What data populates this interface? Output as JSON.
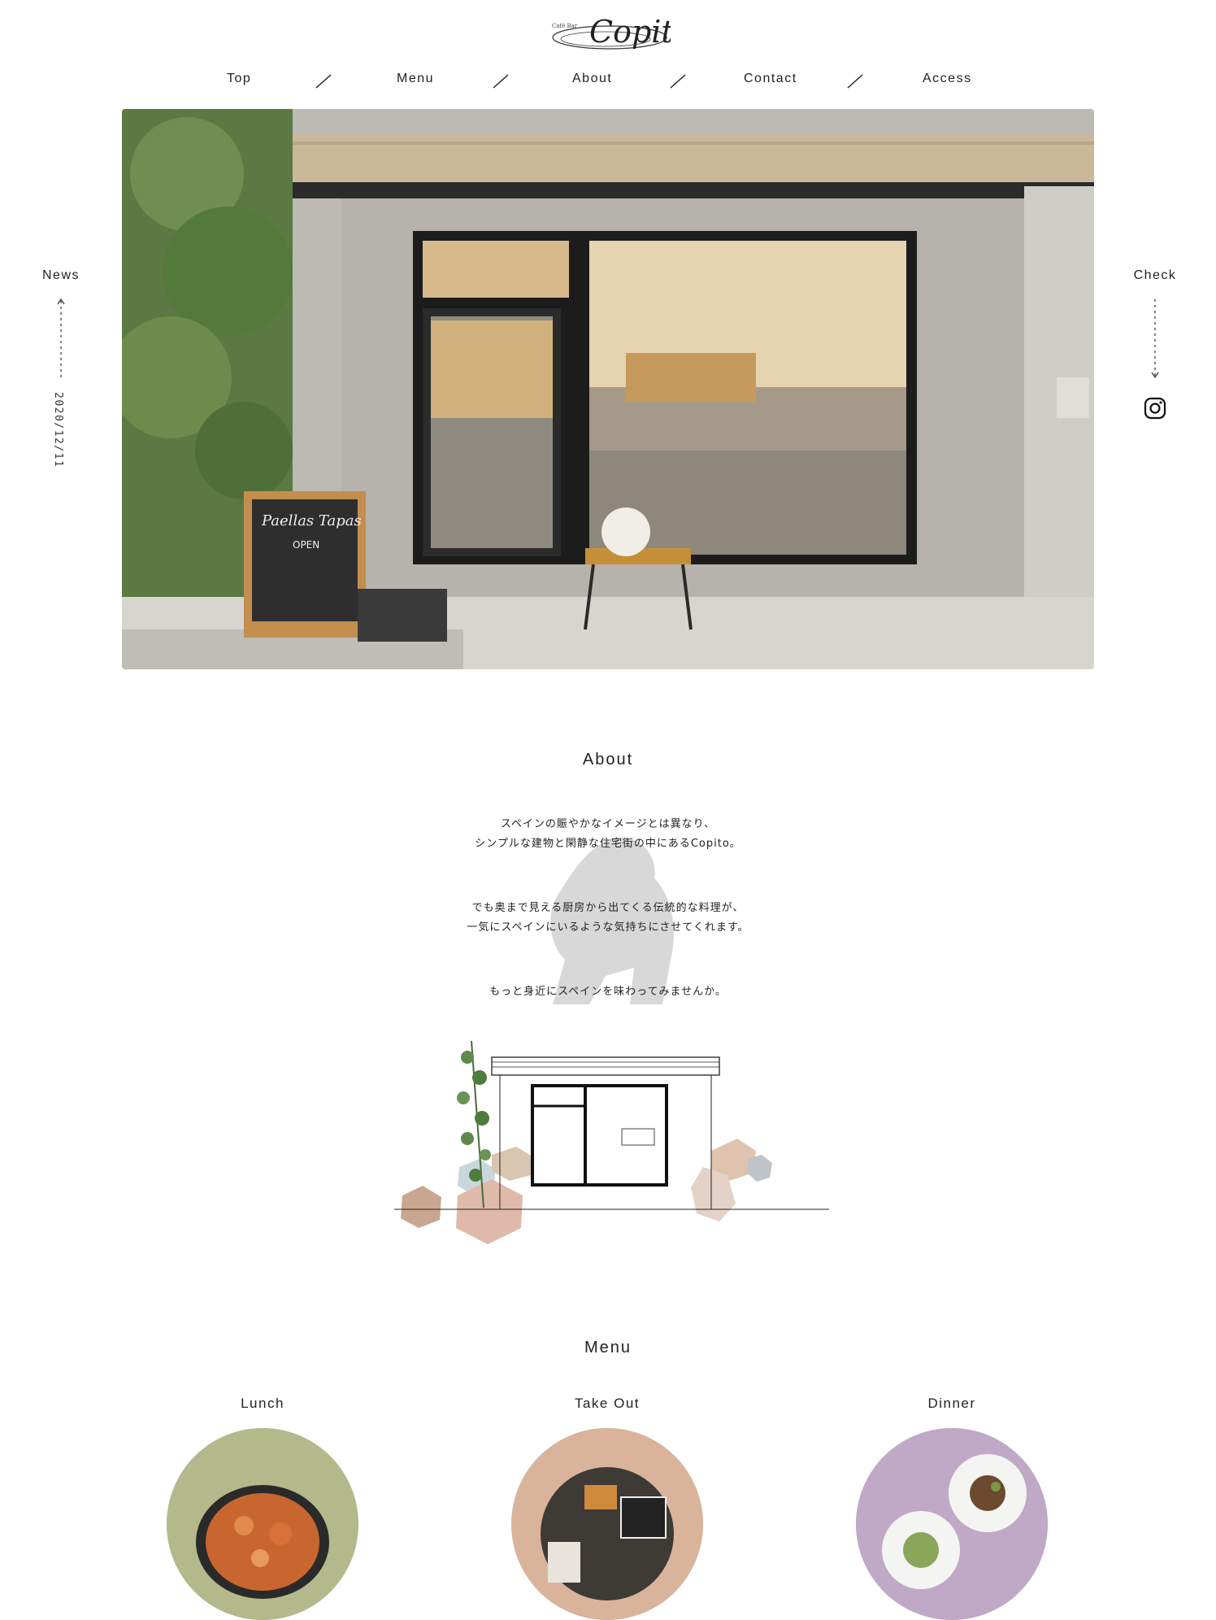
{
  "brand": {
    "logo_small": "Café Bar",
    "logo_text": "Copito"
  },
  "nav": {
    "items": [
      {
        "label": "Top"
      },
      {
        "label": "Menu"
      },
      {
        "label": "About"
      },
      {
        "label": "Contact"
      },
      {
        "label": "Access"
      }
    ]
  },
  "hero": {
    "sign_title": "Paellas Tapas",
    "sign_open": "OPEN"
  },
  "side_left": {
    "label": "News",
    "date": "2020/12/11"
  },
  "side_right": {
    "label": "Check",
    "icon": "instagram-icon"
  },
  "about": {
    "title": "About",
    "paragraphs": [
      [
        "スペインの賑やかなイメージとは異なり、",
        "シンプルな建物と閑静な住宅街の中にあるCopito。"
      ],
      [
        "でも奥まで見える厨房から出てくる伝統的な料理が、",
        "一気にスペインにいるような気持ちにさせてくれます。"
      ],
      [
        "もっと身近にスペインを味わってみませんか。"
      ]
    ]
  },
  "menu": {
    "title": "Menu",
    "cards": [
      {
        "label": "Lunch",
        "color": "#b3b98b"
      },
      {
        "label": "Take Out",
        "color": "#d9b49a"
      },
      {
        "label": "Dinner",
        "color": "#c0a9c6"
      }
    ]
  },
  "colors": {
    "text": "#222222",
    "background": "#ffffff",
    "gorilla": "#d8d8d8"
  }
}
